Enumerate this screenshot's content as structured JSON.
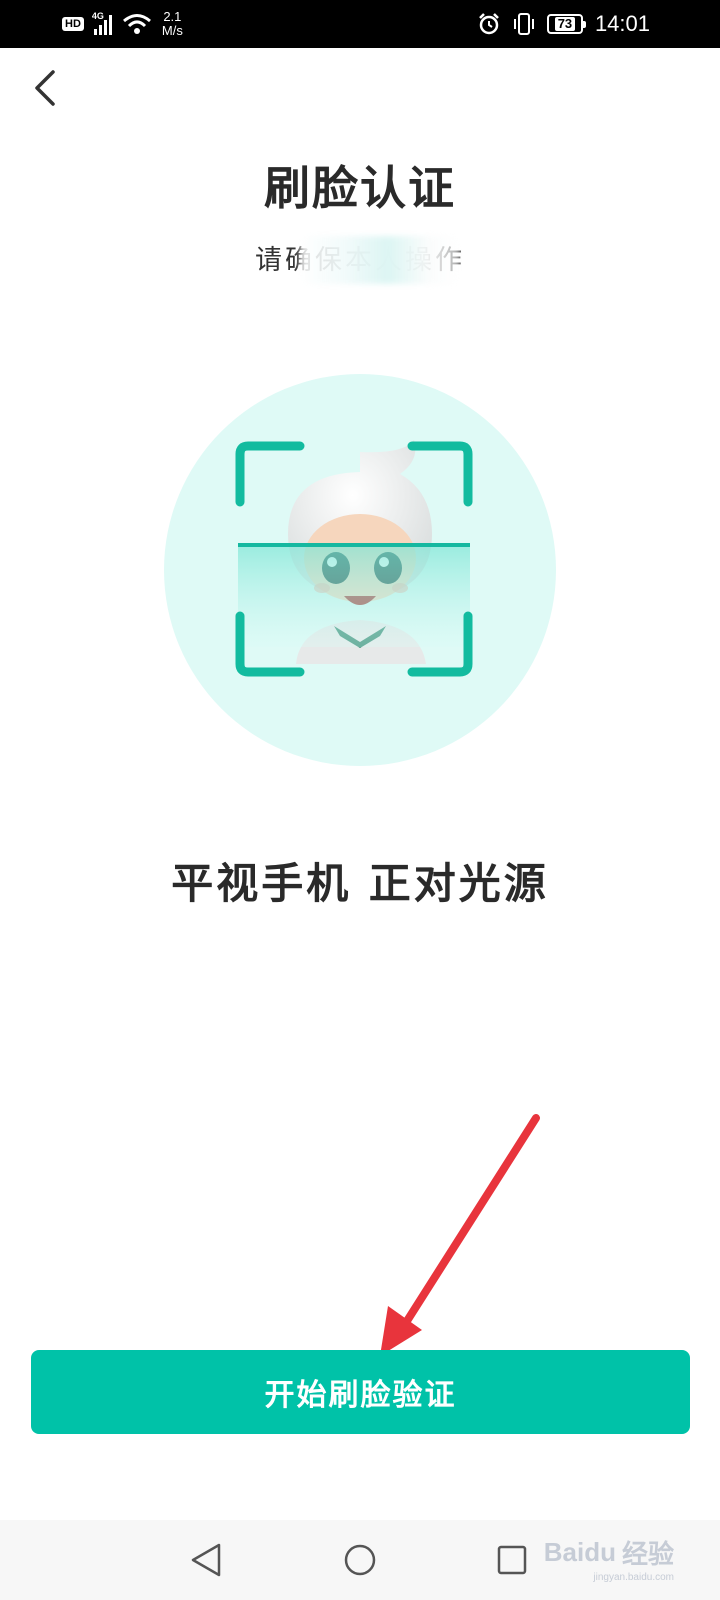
{
  "status_bar": {
    "hd": "HD",
    "network": "4G",
    "speed_value": "2.1",
    "speed_unit": "M/s",
    "battery": "73",
    "time": "14:01"
  },
  "page": {
    "title": "刷脸认证",
    "subtitle": "请确保本人操作",
    "tip": "平视手机 正对光源",
    "primary_button_label": "开始刷脸验证"
  },
  "colors": {
    "accent": "#00c2a8",
    "illustration_bg": "#dffaf6",
    "annotation_arrow": "#e8343c"
  },
  "icons": {
    "back": "chevron-left-icon",
    "nav_back": "triangle-back-icon",
    "nav_home": "circle-home-icon",
    "nav_recent": "square-recent-icon"
  },
  "watermark": {
    "brand": "Baidu",
    "label": "经验",
    "url": "jingyan.baidu.com"
  }
}
